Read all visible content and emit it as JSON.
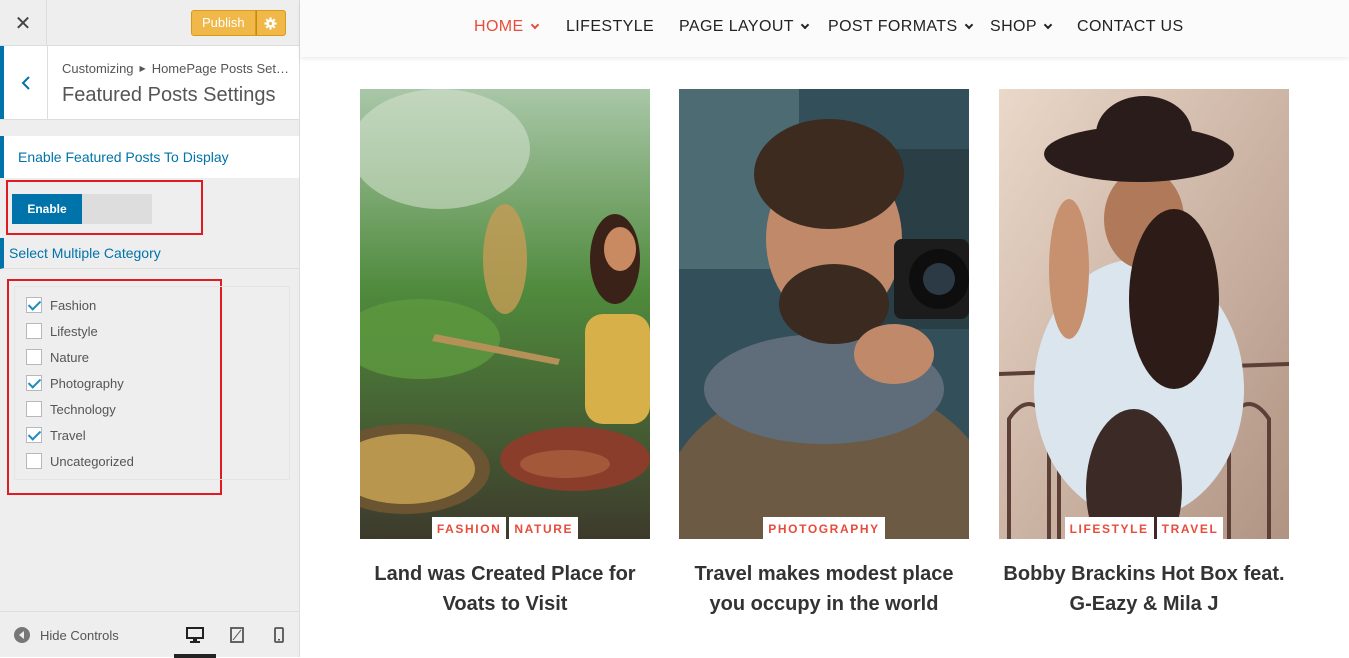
{
  "customizer": {
    "publish_label": "Publish",
    "breadcrumb_root": "Customizing",
    "breadcrumb_panel": "HomePage Posts Setti...",
    "section_title": "Featured Posts Settings",
    "enable_heading": "Enable Featured Posts To Display",
    "toggle_label": "Enable",
    "toggle_enabled": true,
    "category_heading": "Select Multiple Category",
    "categories": [
      {
        "label": "Fashion",
        "checked": true
      },
      {
        "label": "Lifestyle",
        "checked": false
      },
      {
        "label": "Nature",
        "checked": false
      },
      {
        "label": "Photography",
        "checked": true
      },
      {
        "label": "Technology",
        "checked": false
      },
      {
        "label": "Travel",
        "checked": true
      },
      {
        "label": "Uncategorized",
        "checked": false
      }
    ],
    "hide_controls_label": "Hide Controls",
    "active_device": "desktop"
  },
  "nav": {
    "items": [
      {
        "label": "HOME",
        "dropdown": true,
        "active": true
      },
      {
        "label": "LIFESTYLE",
        "dropdown": false,
        "active": false
      },
      {
        "label": "PAGE LAYOUT",
        "dropdown": true,
        "active": false
      },
      {
        "label": "POST FORMATS",
        "dropdown": true,
        "active": false
      },
      {
        "label": "SHOP",
        "dropdown": true,
        "active": false
      },
      {
        "label": "CONTACT US",
        "dropdown": false,
        "active": false
      }
    ]
  },
  "posts": [
    {
      "tags": [
        "FASHION",
        "NATURE"
      ],
      "title_line1": "Land was Created Place for",
      "title_line2": "Voats to Visit"
    },
    {
      "tags": [
        "PHOTOGRAPHY"
      ],
      "title_line1": "Travel makes modest place",
      "title_line2": "you occupy in the world"
    },
    {
      "tags": [
        "LIFESTYLE",
        "TRAVEL"
      ],
      "title_line1": "Bobby Brackins Hot Box feat.",
      "title_line2": "G-Eazy & Mila J"
    }
  ],
  "colors": {
    "accent": "#e74c3c",
    "wp_blue": "#0073aa",
    "publish": "#f0b849",
    "highlight_box": "#e01b24"
  }
}
